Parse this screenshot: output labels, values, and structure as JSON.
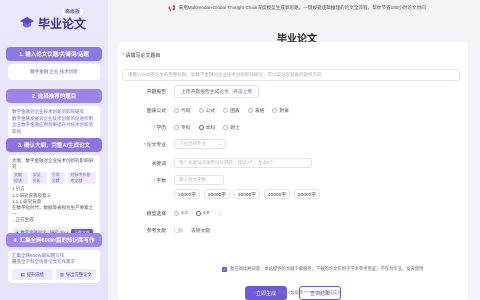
{
  "sidebar": {
    "logo_badge": "高级版",
    "logo_text": "毕业论文",
    "step1": {
      "title": "1. 输入论文议题/关键词/话题",
      "body": "数字金融 企业 技术创新"
    },
    "step2": {
      "title": "2. 选择推荐的题目",
      "lines": [
        "数字金融对企业技术创新的影响研究",
        "数字金融发展对企业技术创新的促进作用",
        "企业数字金融应用效果提升对技术创新的影响"
      ]
    },
    "step3": {
      "title": "3. 确认大纲，完整AI生成论文",
      "lines": [
        "大纲：数字金融对企业技术创新的影响研究",
        "1 引言",
        "1.1 研究背景及意义",
        "1.1.1 研究背景",
        "在数字化时代，数据等被视为生产要素之一",
        "...正在生成"
      ],
      "chips": [
        "文献综述",
        "实证分析",
        "引用文献",
        "对标中外参考文献"
      ],
      "file_name": "数字金融对企...研究.docx",
      "download": "下载文件"
    },
    "step4": {
      "title": "4. 汇集全网600W篇的知识库写作",
      "lines": [
        "汇集全网600W篇知网写作",
        "覆盖全学科全场景论文写作需求"
      ],
      "buttons": [
        "提升成绩",
        "导出完整论文"
      ]
    }
  },
  "banner": {
    "text": "采用Multimodal+Global Thought Chain深度模型生成新思路，一键规避逻辑推理的论文全流程，帮你节省100小时论文时间"
  },
  "page_title": "毕业论文",
  "form": {
    "topic_label": "请填写论文题目",
    "topic_placeholder": "请输入5-50字论文的完整标题，如数字金融对企业技术创新影响研究，可以说说您准备的题目方向",
    "outline_label": "开题报告",
    "outline_hint": "上传开题报告生成论文",
    "outline_link": "点击上传",
    "formula_label": "图表公式",
    "formula_options": [
      "代码",
      "公式",
      "图表",
      "表格",
      "附录"
    ],
    "degree_label": "学历",
    "degree_options": [
      "专科",
      "本科",
      "硕士"
    ],
    "major_label": "论文专业",
    "major_placeholder": "下拉选择专业",
    "keyword_label": "关键词",
    "keyword_placeholder": "每个关键词间请用逗号隔开，建议3个，至多8个",
    "words_label": "字数",
    "words_placeholder": "输入具体字数",
    "word_options": [
      "10000字",
      "20000字",
      "30000字",
      "40000字",
      "50000字"
    ],
    "model_label": "模型选择",
    "model_options": [
      "3.0",
      "4.0"
    ],
    "ref_label": "参考文献",
    "ref_text": "去除文献",
    "btn_generate": "立即生成",
    "btn_query": "查询结果",
    "agree_text": "我已阅读并同意：本站提供的文献下载服务，下载的论文仅用于学术参考借鉴，不作为毕业、发表使用",
    "footer": "05-23分钟前 论文《数据库**********》生成成功"
  }
}
